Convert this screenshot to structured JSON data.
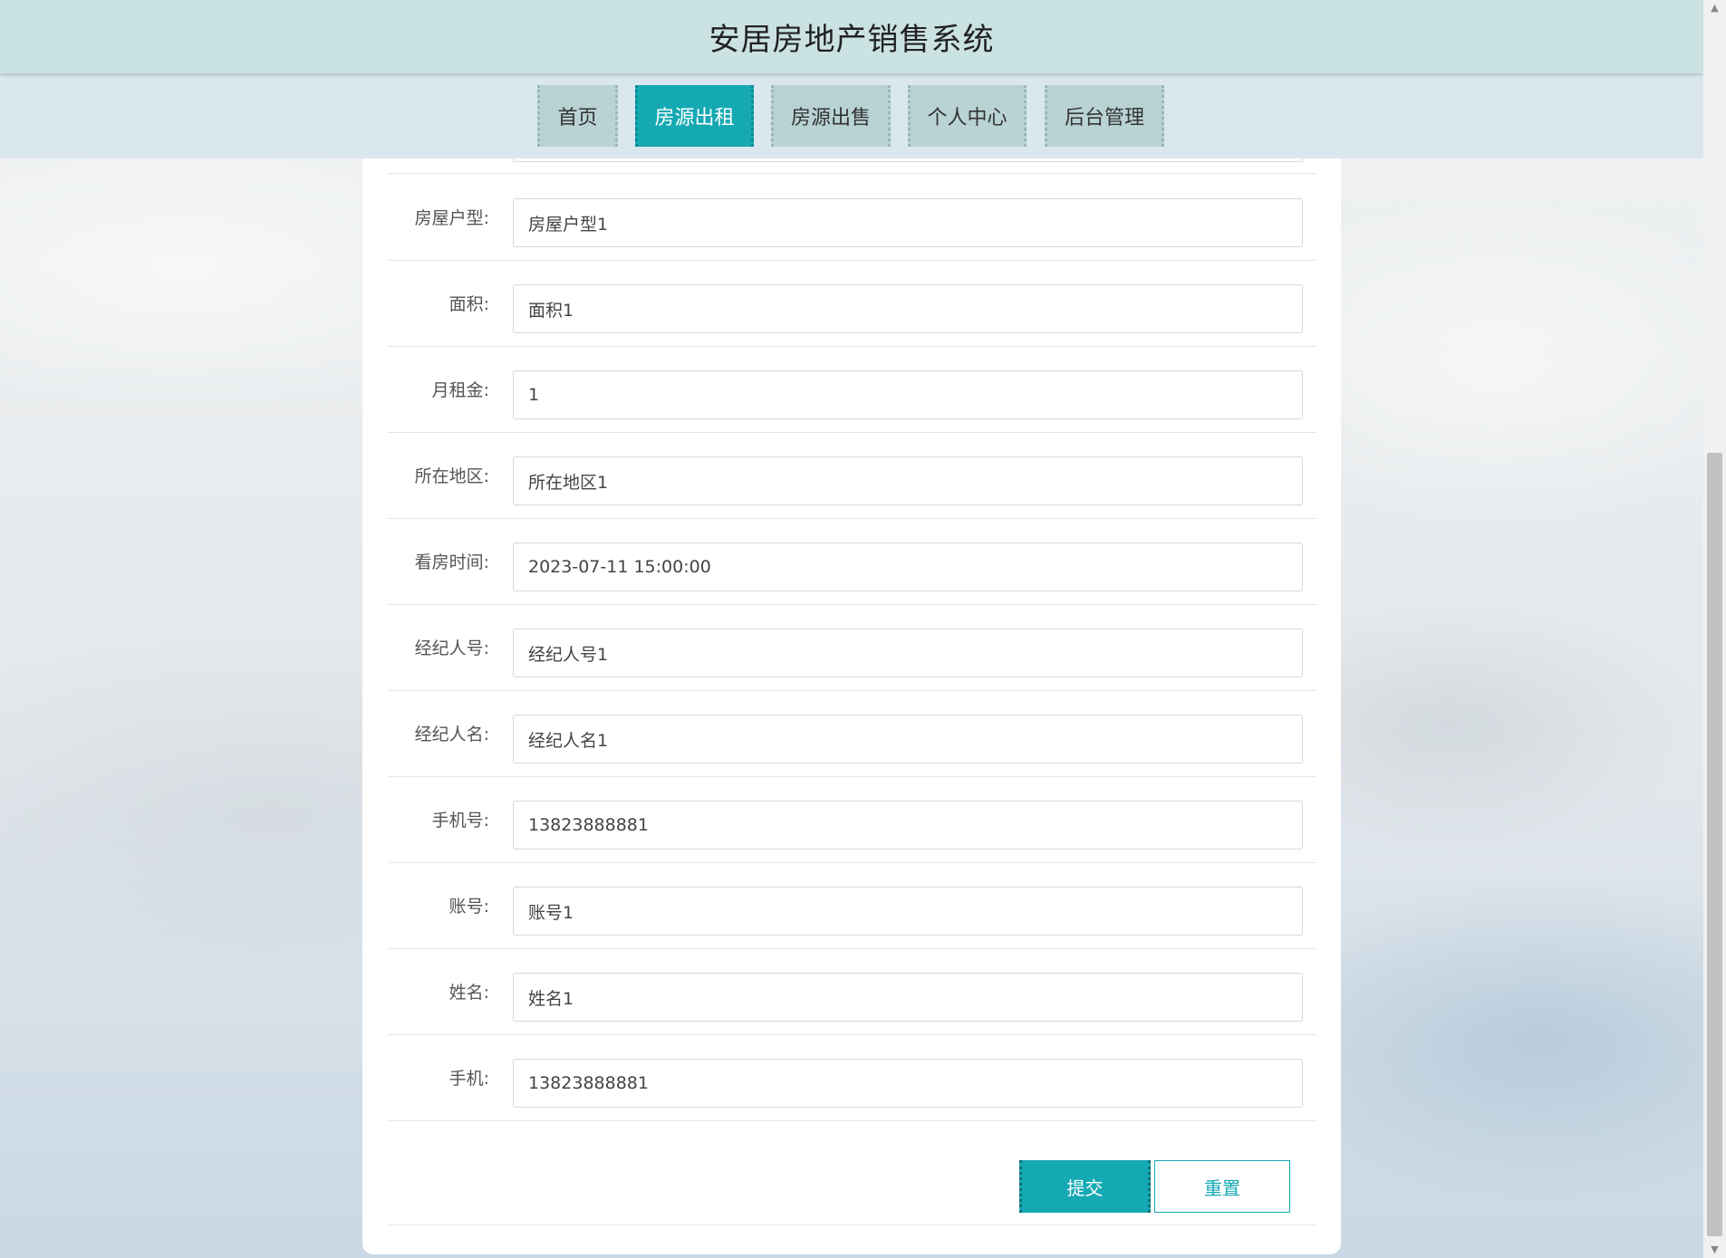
{
  "header": {
    "title": "安居房地产销售系统"
  },
  "nav": {
    "items": [
      {
        "label": "首页"
      },
      {
        "label": "房源出租"
      },
      {
        "label": "房源出售"
      },
      {
        "label": "个人中心"
      },
      {
        "label": "后台管理"
      }
    ],
    "active": "房源出租"
  },
  "form": {
    "fields": [
      {
        "label": "房屋户型:",
        "value": "房屋户型1"
      },
      {
        "label": "面积:",
        "value": "面积1"
      },
      {
        "label": "月租金:",
        "value": "1"
      },
      {
        "label": "所在地区:",
        "value": "所在地区1"
      },
      {
        "label": "看房时间:",
        "value": "2023-07-11 15:00:00"
      },
      {
        "label": "经纪人号:",
        "value": "经纪人号1"
      },
      {
        "label": "经纪人名:",
        "value": "经纪人名1"
      },
      {
        "label": "手机号:",
        "value": "13823888881"
      },
      {
        "label": "账号:",
        "value": "账号1"
      },
      {
        "label": "姓名:",
        "value": "姓名1"
      },
      {
        "label": "手机:",
        "value": "13823888881"
      }
    ],
    "submit_label": "提交",
    "reset_label": "重置"
  },
  "colors": {
    "accent": "#15a9b3",
    "header_bg": "#cbe2e3",
    "nav_bg": "#dae7ef",
    "nav_item_bg": "#b9d2d4"
  },
  "icons": {
    "scroll_up": "scroll-up-arrow-icon",
    "scroll_down": "scroll-down-arrow-icon"
  }
}
